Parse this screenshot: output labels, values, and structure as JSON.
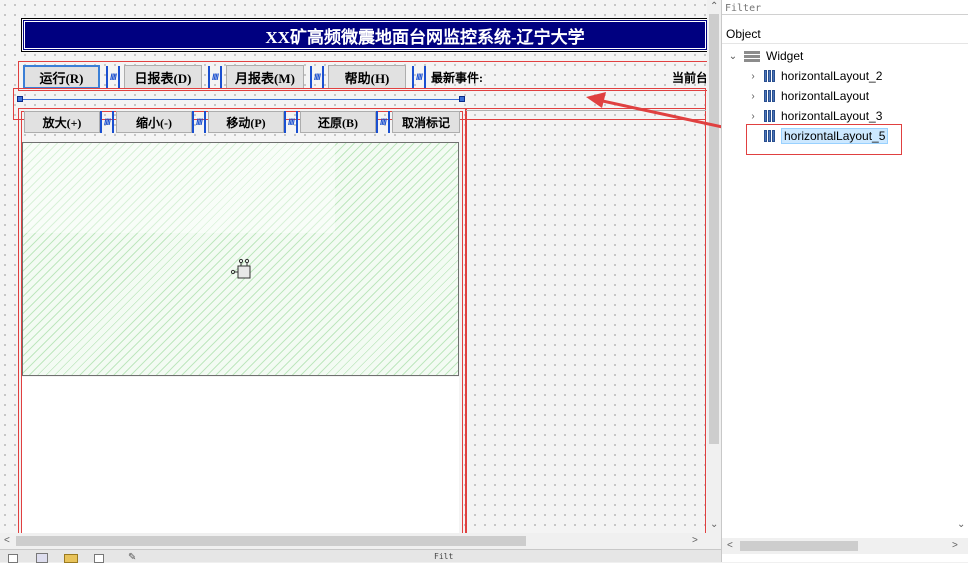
{
  "designer": {
    "title": "XX矿高频微震地面台网监控系统-辽宁大学",
    "toolbar": {
      "run_label": "运行(R)",
      "daily_label": "日报表(D)",
      "monthly_label": "月报表(M)",
      "help_label": "帮助(H)",
      "latest_event_label": "最新事件:",
      "current_label": "当前台"
    },
    "map_toolbar": {
      "zoom_in_label": "放大(+)",
      "zoom_out_label": "缩小(-)",
      "move_label": "移动(P)",
      "restore_label": "还原(B)",
      "cancel_mark_label": "取消标记"
    },
    "spacer_glyph": "////"
  },
  "object_inspector": {
    "filter_placeholder": "Filter",
    "column_header": "Object",
    "root": {
      "label": "Widget"
    },
    "children": [
      {
        "label": "horizontalLayout_2",
        "selected": false
      },
      {
        "label": "horizontalLayout",
        "selected": false
      },
      {
        "label": "horizontalLayout_3",
        "selected": false
      },
      {
        "label": "horizontalLayout_5",
        "selected": true
      }
    ]
  },
  "bottom_strip": {
    "filter_text": "Filt"
  },
  "colors": {
    "banner": "#000080",
    "annotation": "#e04040",
    "selection": "#cce8ff",
    "spacer": "#1a4fd0"
  }
}
